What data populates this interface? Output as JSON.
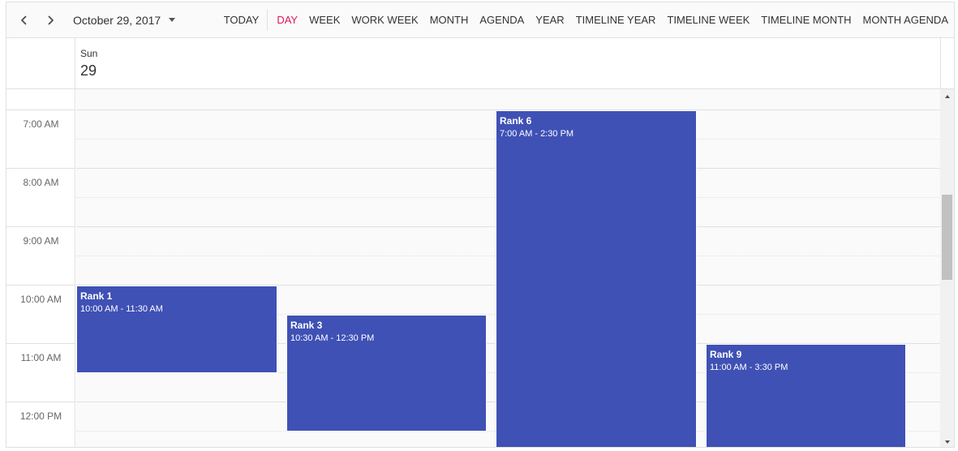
{
  "toolbar": {
    "prev_icon": "chevron-left-icon",
    "next_icon": "chevron-right-icon",
    "date_range": "October 29, 2017",
    "dropdown_icon": "caret-down-icon",
    "today": "TODAY",
    "views": [
      "DAY",
      "WEEK",
      "WORK WEEK",
      "MONTH",
      "AGENDA",
      "YEAR",
      "TIMELINE YEAR",
      "TIMELINE WEEK",
      "TIMELINE MONTH",
      "MONTH AGENDA"
    ],
    "active_view": "DAY",
    "active_color": "#e3165b"
  },
  "header": {
    "day_name": "Sun",
    "day_number": "29"
  },
  "time_slots": [
    "7:00 AM",
    "8:00 AM",
    "9:00 AM",
    "10:00 AM",
    "11:00 AM",
    "12:00 PM"
  ],
  "appointments": [
    {
      "subject": "Rank 1",
      "time": "10:00 AM - 11:30 AM"
    },
    {
      "subject": "Rank 3",
      "time": "10:30 AM - 12:30 PM"
    },
    {
      "subject": "Rank 6",
      "time": "7:00 AM - 2:30 PM"
    },
    {
      "subject": "Rank 9",
      "time": "11:00 AM - 3:30 PM"
    }
  ],
  "appointment_color": "#3f51b5"
}
